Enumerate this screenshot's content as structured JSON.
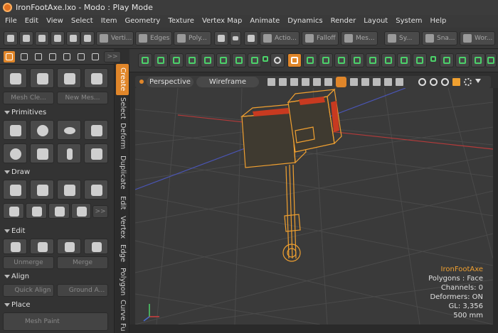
{
  "window": {
    "title": "IronFootAxe.lxo - Modo : Play Mode"
  },
  "menu": [
    "File",
    "Edit",
    "View",
    "Select",
    "Item",
    "Geometry",
    "Texture",
    "Vertex Map",
    "Animate",
    "Dynamics",
    "Render",
    "Layout",
    "System",
    "Help"
  ],
  "toolbar": {
    "vertices": "Verti...",
    "edges": "Edges",
    "polygons": "Poly...",
    "action_center": "Actio...",
    "falloff": "Falloff",
    "mesh": "Mes...",
    "symmetry": "Sy...",
    "snap": "Sna...",
    "workplane": "Wor...",
    "more": ">>"
  },
  "left_panel": {
    "mesh_cleanup": "Mesh Cle...",
    "new_mesh": "New Mes...",
    "sections": {
      "primitives": "Primitives",
      "draw": "Draw",
      "edit": "Edit",
      "align": "Align",
      "place": "Place"
    },
    "unmerge": "Unmerge",
    "merge": "Merge",
    "quick_align": "Quick Align",
    "ground": "Ground A...",
    "mesh_paint": "Mesh Paint",
    "more": ">>"
  },
  "vertical_tabs": [
    "Create",
    "Select",
    "Deform",
    "Duplicate",
    "Edit",
    "Vertex",
    "Edge",
    "Polygon",
    "Curve",
    "Fu"
  ],
  "viewport_header": {
    "view": "Perspective",
    "shading": "Wireframe",
    "more": ">>"
  },
  "viewport_info": {
    "item": "IronFootAxe",
    "polygons": "Polygons : Face",
    "channels": "Channels: 0",
    "deformers": "Deformers: ON",
    "gl": "GL: 3,356",
    "units": "500 mm"
  },
  "colors": {
    "accent": "#e0862a",
    "select": "#f0a030",
    "green_icons": "#4cd16a"
  }
}
